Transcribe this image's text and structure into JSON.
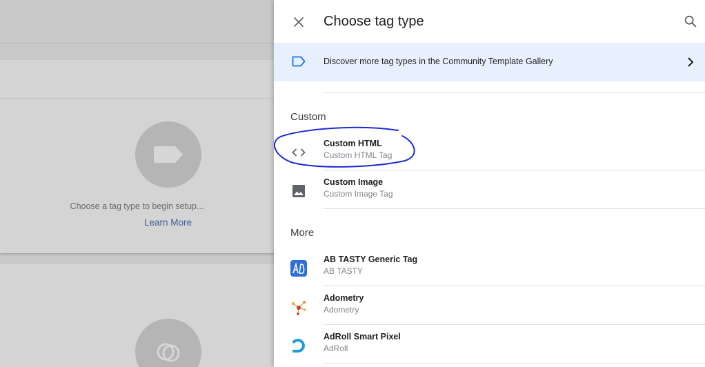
{
  "background": {
    "setup_text": "Choose a tag type to begin setup...",
    "learn_more": "Learn More"
  },
  "panel": {
    "title": "Choose tag type",
    "close_icon": "close-icon",
    "search_icon": "search-icon"
  },
  "banner": {
    "text": "Discover more tag types in the Community Template Gallery",
    "icon": "tag-outline-icon",
    "accent": "#1a73e8",
    "background": "#e8f0fe"
  },
  "sections": {
    "custom": {
      "heading": "Custom",
      "items": [
        {
          "name": "Custom HTML",
          "sub": "Custom HTML Tag",
          "icon": "code-icon"
        },
        {
          "name": "Custom Image",
          "sub": "Custom Image Tag",
          "icon": "image-icon"
        }
      ]
    },
    "more": {
      "heading": "More",
      "items": [
        {
          "name": "AB TASTY Generic Tag",
          "sub": "AB TASTY",
          "icon": "ab-tasty-icon"
        },
        {
          "name": "Adometry",
          "sub": "Adometry",
          "icon": "adometry-icon"
        },
        {
          "name": "AdRoll Smart Pixel",
          "sub": "AdRoll",
          "icon": "adroll-icon"
        }
      ]
    }
  },
  "annotation_color": "#1a2bd6"
}
